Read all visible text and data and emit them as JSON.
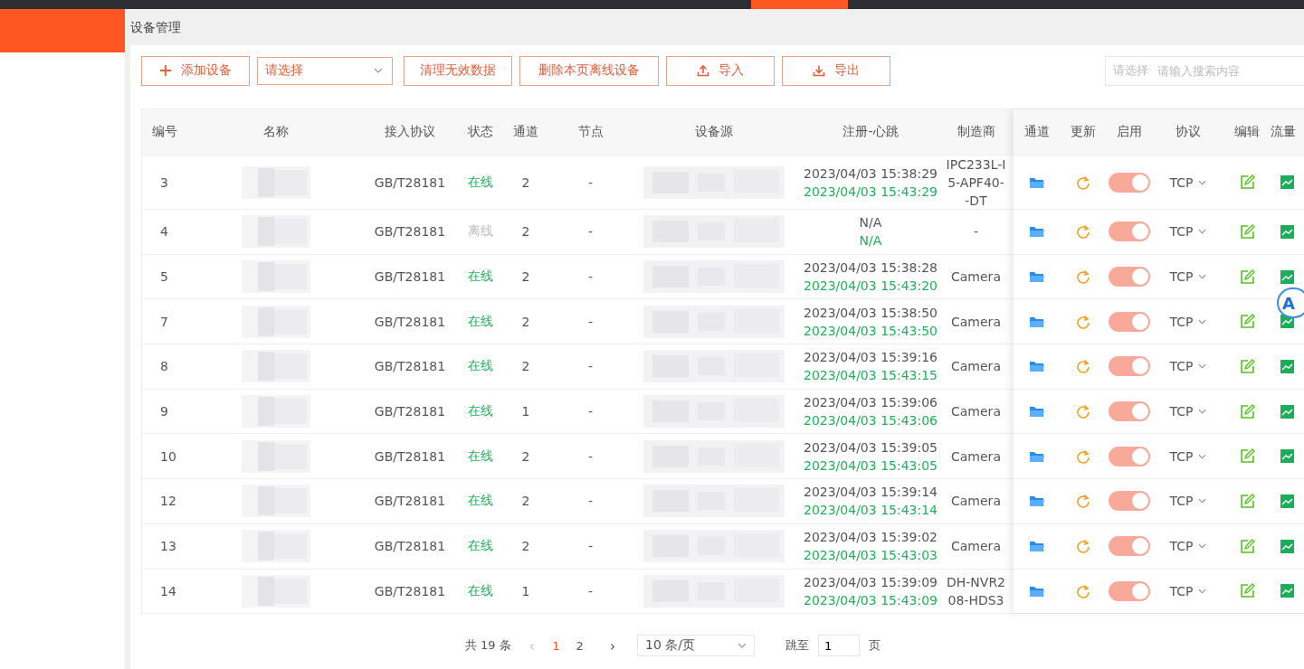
{
  "page_title": "设备管理",
  "toolbar": {
    "add_button": "添加设备",
    "filter_select": {
      "placeholder": "请选择"
    },
    "clean_button": "清理无效数据",
    "delete_offline_button": "删除本页离线设备",
    "import_button": "导入",
    "export_button": "导出"
  },
  "search": {
    "type_select": {
      "placeholder": "请选择"
    },
    "placeholder": "请输入搜索内容"
  },
  "table": {
    "columns": [
      "编号",
      "名称",
      "接入协议",
      "状态",
      "通道",
      "节点",
      "设备源",
      "注册-心跳",
      "制造商"
    ],
    "fixed_columns": [
      "通道",
      "更新",
      "启用",
      "协议",
      "编辑",
      "流量"
    ],
    "rows": [
      {
        "id": "3",
        "protocol": "GB/T28181",
        "status": "在线",
        "online": true,
        "channels": "2",
        "node": "-",
        "register": "2023/04/03 15:38:29",
        "heartbeat": "2023/04/03 15:43:29",
        "manufacturer": [
          "IPC233L-I",
          "5-APF40-",
          "-DT"
        ],
        "enabled": true,
        "transport": "TCP"
      },
      {
        "id": "4",
        "protocol": "GB/T28181",
        "status": "离线",
        "online": false,
        "channels": "2",
        "node": "-",
        "register": "N/A",
        "heartbeat": "N/A",
        "manufacturer": [
          "-"
        ],
        "enabled": true,
        "transport": "TCP"
      },
      {
        "id": "5",
        "protocol": "GB/T28181",
        "status": "在线",
        "online": true,
        "channels": "2",
        "node": "-",
        "register": "2023/04/03 15:38:28",
        "heartbeat": "2023/04/03 15:43:20",
        "manufacturer": [
          "Camera"
        ],
        "enabled": true,
        "transport": "TCP"
      },
      {
        "id": "7",
        "protocol": "GB/T28181",
        "status": "在线",
        "online": true,
        "channels": "2",
        "node": "-",
        "register": "2023/04/03 15:38:50",
        "heartbeat": "2023/04/03 15:43:50",
        "manufacturer": [
          "Camera"
        ],
        "enabled": true,
        "transport": "TCP"
      },
      {
        "id": "8",
        "protocol": "GB/T28181",
        "status": "在线",
        "online": true,
        "channels": "2",
        "node": "-",
        "register": "2023/04/03 15:39:16",
        "heartbeat": "2023/04/03 15:43:15",
        "manufacturer": [
          "Camera"
        ],
        "enabled": true,
        "transport": "TCP"
      },
      {
        "id": "9",
        "protocol": "GB/T28181",
        "status": "在线",
        "online": true,
        "channels": "1",
        "node": "-",
        "register": "2023/04/03 15:39:06",
        "heartbeat": "2023/04/03 15:43:06",
        "manufacturer": [
          "Camera"
        ],
        "enabled": true,
        "transport": "TCP"
      },
      {
        "id": "10",
        "protocol": "GB/T28181",
        "status": "在线",
        "online": true,
        "channels": "2",
        "node": "-",
        "register": "2023/04/03 15:39:05",
        "heartbeat": "2023/04/03 15:43:05",
        "manufacturer": [
          "Camera"
        ],
        "enabled": true,
        "transport": "TCP"
      },
      {
        "id": "12",
        "protocol": "GB/T28181",
        "status": "在线",
        "online": true,
        "channels": "2",
        "node": "-",
        "register": "2023/04/03 15:39:14",
        "heartbeat": "2023/04/03 15:43:14",
        "manufacturer": [
          "Camera"
        ],
        "enabled": true,
        "transport": "TCP"
      },
      {
        "id": "13",
        "protocol": "GB/T28181",
        "status": "在线",
        "online": true,
        "channels": "2",
        "node": "-",
        "register": "2023/04/03 15:39:02",
        "heartbeat": "2023/04/03 15:43:03",
        "manufacturer": [
          "Camera"
        ],
        "enabled": true,
        "transport": "TCP"
      },
      {
        "id": "14",
        "protocol": "GB/T28181",
        "status": "在线",
        "online": true,
        "channels": "1",
        "node": "-",
        "register": "2023/04/03 15:39:09",
        "heartbeat": "2023/04/03 15:43:09",
        "manufacturer": [
          "DH-NVR2",
          "08-HDS3"
        ],
        "enabled": true,
        "transport": "TCP"
      }
    ]
  },
  "pagination": {
    "total": "共 19 条",
    "prev": "‹",
    "pages": [
      {
        "label": "1",
        "selected": true
      },
      {
        "label": "2",
        "selected": false
      }
    ],
    "next": "›",
    "page_size": "10 条/页",
    "jump_label": "跳至",
    "jump_value": "1",
    "page_unit": "页"
  },
  "floating_button": {
    "label": "A"
  }
}
